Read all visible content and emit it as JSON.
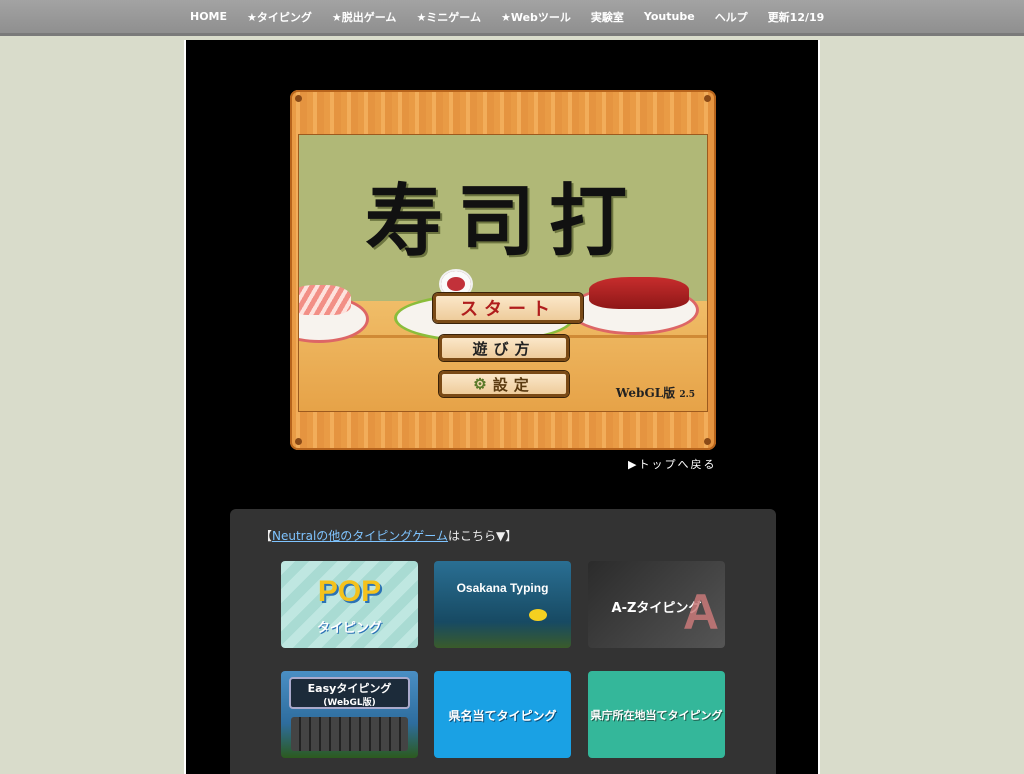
{
  "nav": {
    "items": [
      "HOME",
      "★タイピング",
      "★脱出ゲーム",
      "★ミニゲーム",
      "★Webツール",
      "実験室",
      "Youtube",
      "ヘルプ",
      "更新12/19"
    ]
  },
  "game": {
    "title": "寿司打",
    "start_label": "スタート",
    "howto_label": "遊び方",
    "settings_label": "設定",
    "version_label": "WebGL版",
    "version_number": "2.5"
  },
  "back_to_top": "▶トップへ戻る",
  "panel": {
    "heading_prefix": "【",
    "heading_link": "Neutralの他のタイピングゲーム",
    "heading_suffix": "はこちら▼】",
    "tiles": [
      {
        "line1": "POP",
        "line2": "タイピング"
      },
      {
        "line1": "Osakana Typing",
        "line2": ""
      },
      {
        "line1": "A-Zタイピング",
        "line2": "A"
      },
      {
        "line1": "Easyタイピング",
        "line2": "(WebGL版)"
      },
      {
        "line1": "県名当てタイピング",
        "line2": ""
      },
      {
        "line1": "県庁所在地当てタイピング",
        "line2": ""
      }
    ]
  },
  "colors": {
    "page_bg": "#d9dccb",
    "nav_bg": "#999999",
    "wood": "#e99b45",
    "screen_bg": "#b0b877",
    "start_text": "#b01d1d"
  }
}
